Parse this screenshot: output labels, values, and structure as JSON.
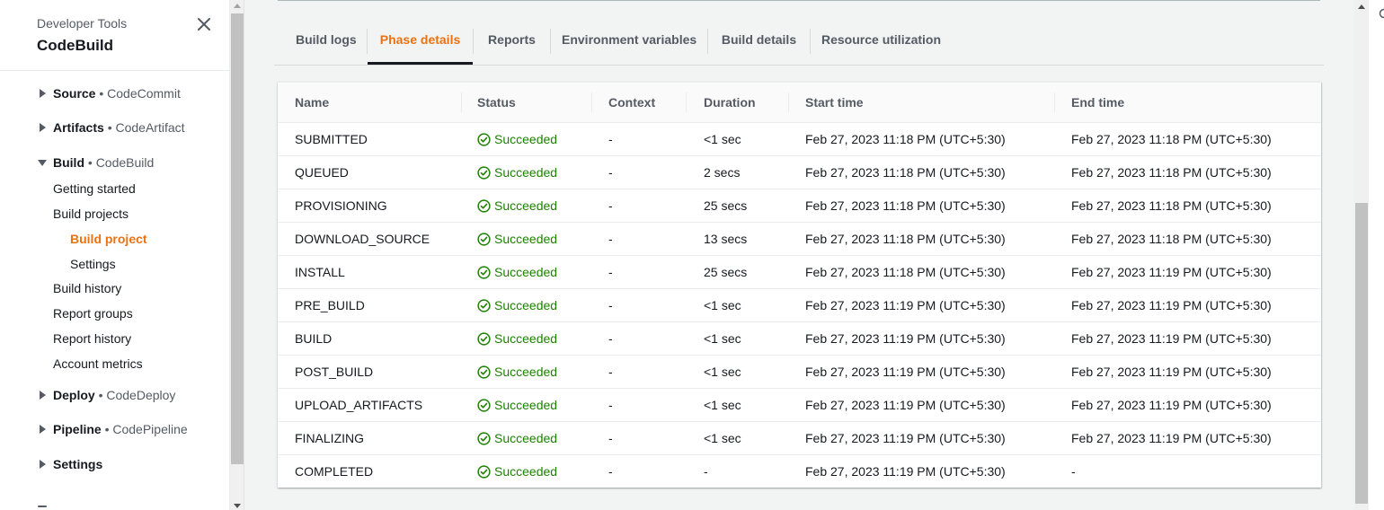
{
  "sidebar": {
    "supertitle": "Developer Tools",
    "title": "CodeBuild",
    "groups": [
      {
        "label": "Source",
        "sub": "CodeCommit",
        "expanded": false
      },
      {
        "label": "Artifacts",
        "sub": "CodeArtifact",
        "expanded": false
      },
      {
        "label": "Build",
        "sub": "CodeBuild",
        "expanded": true
      },
      {
        "label": "Deploy",
        "sub": "CodeDeploy",
        "expanded": false
      },
      {
        "label": "Pipeline",
        "sub": "CodePipeline",
        "expanded": false
      },
      {
        "label": "Settings",
        "sub": "",
        "expanded": false
      }
    ],
    "build_items": [
      {
        "label": "Getting started"
      },
      {
        "label": "Build projects"
      },
      {
        "label": "Build project",
        "active": true
      },
      {
        "label": "Settings"
      },
      {
        "label": "Build history"
      },
      {
        "label": "Report groups"
      },
      {
        "label": "Report history"
      },
      {
        "label": "Account metrics"
      }
    ],
    "separator": "•"
  },
  "tabs": [
    {
      "label": "Build logs"
    },
    {
      "label": "Phase details",
      "active": true
    },
    {
      "label": "Reports"
    },
    {
      "label": "Environment variables"
    },
    {
      "label": "Build details"
    },
    {
      "label": "Resource utilization"
    }
  ],
  "table": {
    "columns": [
      "Name",
      "Status",
      "Context",
      "Duration",
      "Start time",
      "End time"
    ],
    "rows": [
      {
        "name": "SUBMITTED",
        "status": "Succeeded",
        "context": "-",
        "duration": "<1 sec",
        "start": "Feb 27, 2023 11:18 PM (UTC+5:30)",
        "end": "Feb 27, 2023 11:18 PM (UTC+5:30)"
      },
      {
        "name": "QUEUED",
        "status": "Succeeded",
        "context": "-",
        "duration": "2 secs",
        "start": "Feb 27, 2023 11:18 PM (UTC+5:30)",
        "end": "Feb 27, 2023 11:18 PM (UTC+5:30)"
      },
      {
        "name": "PROVISIONING",
        "status": "Succeeded",
        "context": "-",
        "duration": "25 secs",
        "start": "Feb 27, 2023 11:18 PM (UTC+5:30)",
        "end": "Feb 27, 2023 11:18 PM (UTC+5:30)"
      },
      {
        "name": "DOWNLOAD_SOURCE",
        "status": "Succeeded",
        "context": "-",
        "duration": "13 secs",
        "start": "Feb 27, 2023 11:18 PM (UTC+5:30)",
        "end": "Feb 27, 2023 11:18 PM (UTC+5:30)"
      },
      {
        "name": "INSTALL",
        "status": "Succeeded",
        "context": "-",
        "duration": "25 secs",
        "start": "Feb 27, 2023 11:18 PM (UTC+5:30)",
        "end": "Feb 27, 2023 11:19 PM (UTC+5:30)"
      },
      {
        "name": "PRE_BUILD",
        "status": "Succeeded",
        "context": "-",
        "duration": "<1 sec",
        "start": "Feb 27, 2023 11:19 PM (UTC+5:30)",
        "end": "Feb 27, 2023 11:19 PM (UTC+5:30)"
      },
      {
        "name": "BUILD",
        "status": "Succeeded",
        "context": "-",
        "duration": "<1 sec",
        "start": "Feb 27, 2023 11:19 PM (UTC+5:30)",
        "end": "Feb 27, 2023 11:19 PM (UTC+5:30)"
      },
      {
        "name": "POST_BUILD",
        "status": "Succeeded",
        "context": "-",
        "duration": "<1 sec",
        "start": "Feb 27, 2023 11:19 PM (UTC+5:30)",
        "end": "Feb 27, 2023 11:19 PM (UTC+5:30)"
      },
      {
        "name": "UPLOAD_ARTIFACTS",
        "status": "Succeeded",
        "context": "-",
        "duration": "<1 sec",
        "start": "Feb 27, 2023 11:19 PM (UTC+5:30)",
        "end": "Feb 27, 2023 11:19 PM (UTC+5:30)"
      },
      {
        "name": "FINALIZING",
        "status": "Succeeded",
        "context": "-",
        "duration": "<1 sec",
        "start": "Feb 27, 2023 11:19 PM (UTC+5:30)",
        "end": "Feb 27, 2023 11:19 PM (UTC+5:30)"
      },
      {
        "name": "COMPLETED",
        "status": "Succeeded",
        "context": "-",
        "duration": "-",
        "start": "Feb 27, 2023 11:19 PM (UTC+5:30)",
        "end": "-"
      }
    ]
  },
  "icons": {
    "close": "close-icon",
    "caret_right": "caret-right-icon",
    "caret_down": "caret-down-icon",
    "status_ok": "check-circle-icon"
  },
  "colors": {
    "accent": "#ec7211",
    "success": "#1d8102",
    "text": "#16191f",
    "muted": "#545b64",
    "border": "#eaeded",
    "page_bg": "#f2f3f3"
  }
}
